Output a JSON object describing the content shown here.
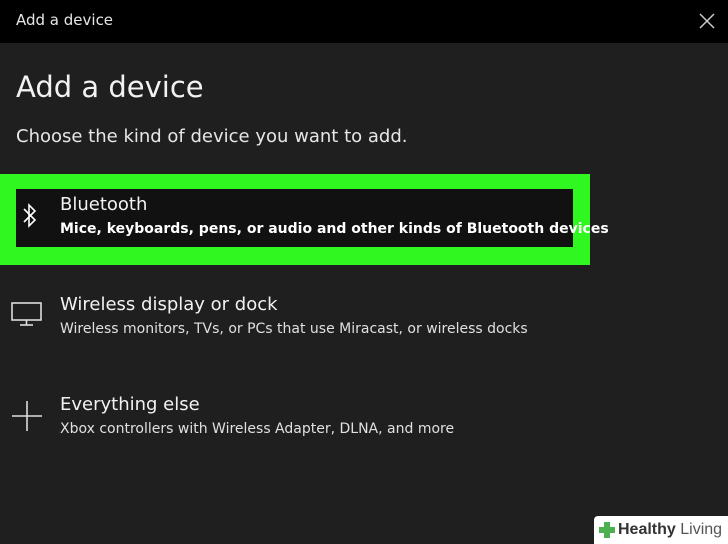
{
  "window": {
    "title": "Add a device"
  },
  "main": {
    "heading": "Add a device",
    "subheading": "Choose the kind of device you want to add."
  },
  "options": [
    {
      "title": "Bluetooth",
      "description": "Mice, keyboards, pens, or audio and other kinds of Bluetooth devices",
      "icon": "bluetooth-icon",
      "selected": true
    },
    {
      "title": "Wireless display or dock",
      "description": "Wireless monitors, TVs, or PCs that use Miracast, or wireless docks",
      "icon": "monitor-icon",
      "selected": false
    },
    {
      "title": "Everything else",
      "description": "Xbox controllers with Wireless Adapter, DLNA, and more",
      "icon": "plus-icon",
      "selected": false
    }
  ],
  "watermark": {
    "brand_bold": "Healthy",
    "brand_rest": " Living"
  },
  "colors": {
    "highlight": "#2ff71f",
    "background": "#1f1f1f",
    "titlebar": "#000000"
  }
}
